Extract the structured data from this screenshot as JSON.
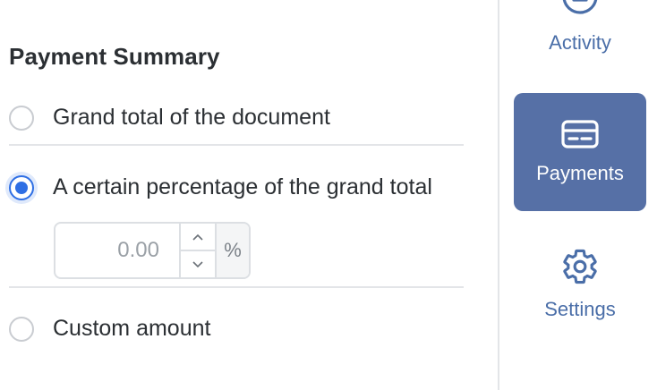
{
  "payment_summary": {
    "title": "Payment Summary",
    "options": [
      {
        "label": "Grand total of the document",
        "selected": false
      },
      {
        "label": "A certain percentage of the grand total",
        "selected": true
      },
      {
        "label": "Custom amount",
        "selected": false
      }
    ],
    "percentage": {
      "placeholder": "0.00",
      "suffix": "%"
    }
  },
  "rail": {
    "items": [
      {
        "label": "Activity",
        "icon": "activity-icon",
        "active": false
      },
      {
        "label": "Payments",
        "icon": "card-icon",
        "active": true
      },
      {
        "label": "Settings",
        "icon": "gear-icon",
        "active": false
      }
    ]
  },
  "colors": {
    "accent": "#2f6fe4",
    "rail_active_bg": "#5670a6",
    "rail_text": "#4a6ea8"
  }
}
